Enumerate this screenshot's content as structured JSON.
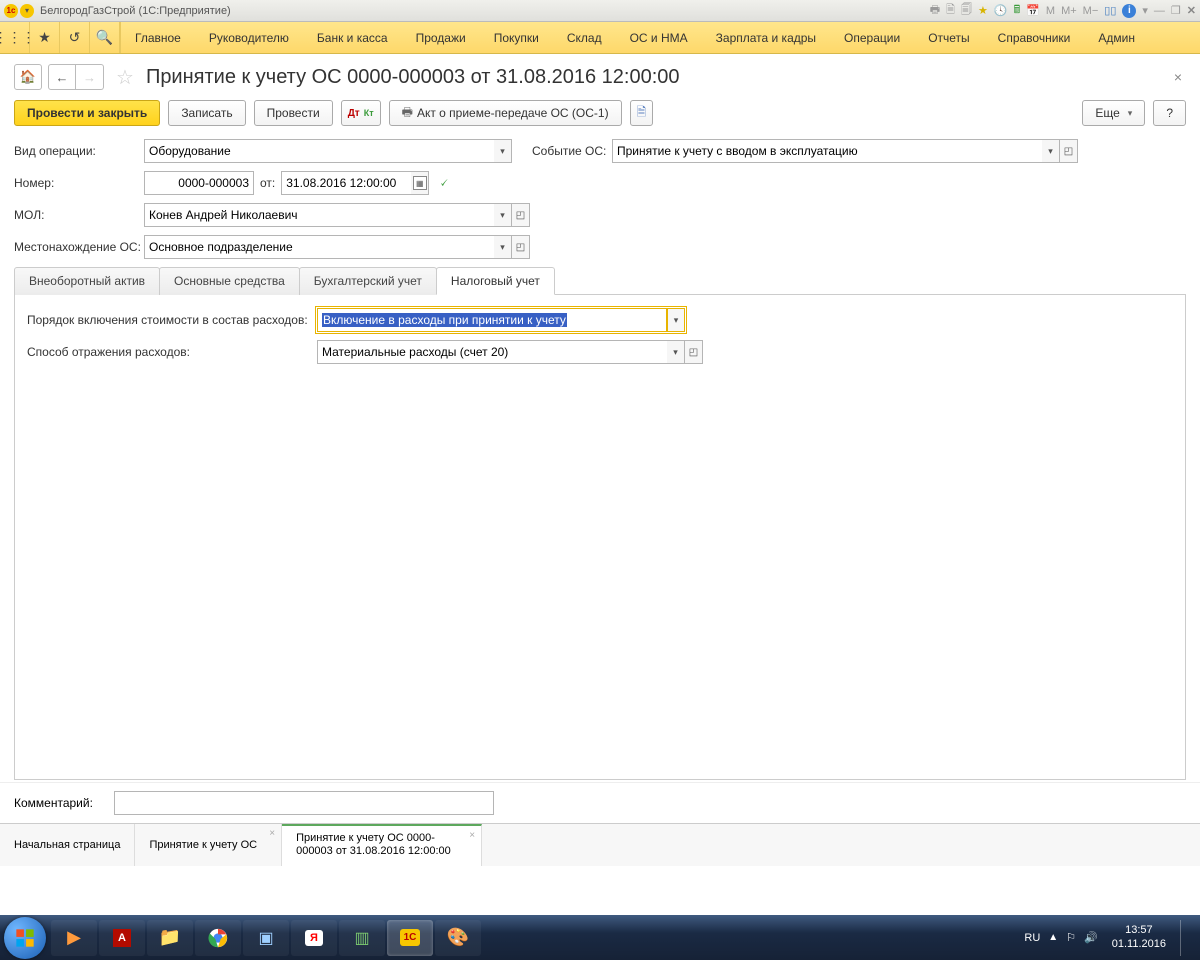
{
  "window": {
    "title": "БелгородГазСтрой  (1С:Предприятие)"
  },
  "main_menu": {
    "items": [
      "Главное",
      "Руководителю",
      "Банк и касса",
      "Продажи",
      "Покупки",
      "Склад",
      "ОС и НМА",
      "Зарплата и кадры",
      "Операции",
      "Отчеты",
      "Справочники",
      "Админ"
    ]
  },
  "page": {
    "title": "Принятие к учету ОС 0000-000003 от 31.08.2016 12:00:00",
    "actions": {
      "post_close": "Провести и закрыть",
      "save": "Записать",
      "post": "Провести",
      "print_act": "Акт о приеме-передаче ОС (ОС-1)",
      "more": "Еще",
      "help": "?"
    },
    "fields": {
      "operation_type_label": "Вид операции:",
      "operation_type_value": "Оборудование",
      "event_label": "Событие ОС:",
      "event_value": "Принятие к учету с вводом в эксплуатацию",
      "number_label": "Номер:",
      "number_value": "0000-000003",
      "from_label": "от:",
      "date_value": "31.08.2016 12:00:00",
      "mol_label": "МОЛ:",
      "mol_value": "Конев Андрей Николаевич",
      "location_label": "Местонахождение ОС:",
      "location_value": "Основное подразделение"
    },
    "tabs": [
      "Внеоборотный актив",
      "Основные средства",
      "Бухгалтерский учет",
      "Налоговый учет"
    ],
    "active_tab": 3,
    "tax_tab": {
      "order_label": "Порядок включения стоимости в состав расходов:",
      "order_value": "Включение в расходы при принятии к учету",
      "method_label": "Способ отражения расходов:",
      "method_value": "Материальные расходы (счет 20)"
    },
    "comment_label": "Комментарий:",
    "comment_value": ""
  },
  "bottom_tabs": {
    "items": [
      {
        "label": "Начальная страница"
      },
      {
        "label": "Принятие к учету ОС"
      },
      {
        "label": "Принятие к учету ОС 0000-000003 от 31.08.2016 12:00:00"
      }
    ],
    "active": 2
  },
  "taskbar": {
    "lang": "RU",
    "time": "13:57",
    "date": "01.11.2016"
  }
}
